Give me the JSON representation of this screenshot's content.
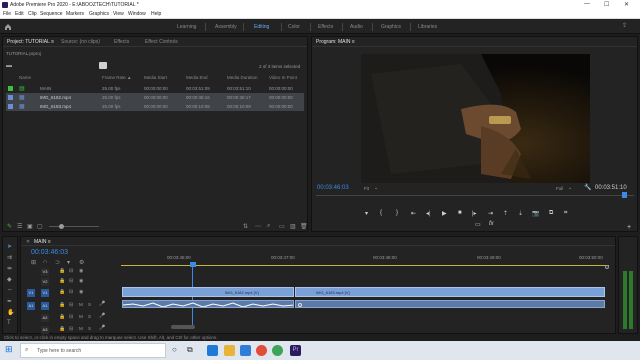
{
  "app": {
    "window_title": "Adobe Premiere Pro 2020 - E:\\ABOOZTECH\\TUTORIAL *",
    "minimize": "—",
    "maximize": "☐",
    "close": "✕"
  },
  "menu": [
    "File",
    "Edit",
    "Clip",
    "Sequence",
    "Markers",
    "Graphics",
    "View",
    "Window",
    "Help"
  ],
  "workspaces": {
    "home_icon": "home-icon",
    "items": [
      "Learning",
      "Assembly",
      "Editing",
      "Color",
      "Effects",
      "Audio",
      "Graphics",
      "Libraries"
    ],
    "active": "Editing"
  },
  "project_panel": {
    "tabs": [
      "Project: TUTORIAL ≡",
      "Source: (no clips)",
      "Effects",
      "Effect Controls"
    ],
    "file_name": "TUTORIAL.prproj",
    "selection_status": "2 of 3 items selected",
    "columns": [
      "Name",
      "Frame Rate ▲",
      "Media Start",
      "Media End",
      "Media Duration",
      "Video In Point"
    ],
    "rows": [
      {
        "name": "MAIN",
        "frame_rate": "25.00 fps",
        "start": "00:00:00:00",
        "end": "00:03:51:09",
        "duration": "00:03:51:10",
        "in_point": "00:00:00:00",
        "color": "#3dbf3d",
        "selected": false
      },
      {
        "name": "IMG_6182.mp4",
        "frame_rate": "25.00 fps",
        "start": "00:00:00:00",
        "end": "00:00:36:16",
        "duration": "00:00:36:17",
        "in_point": "00:00:00:00",
        "color": "#6b8dd6",
        "selected": true
      },
      {
        "name": "IMG_6183.mp4",
        "frame_rate": "25.00 fps",
        "start": "00:00:00:00",
        "end": "00:00:10:08",
        "duration": "00:00:10:09",
        "in_point": "00:00:00:00",
        "color": "#6b8dd6",
        "selected": true
      }
    ]
  },
  "program_monitor": {
    "tab": "Program: MAIN ≡",
    "current_time": "00:03:46:03",
    "fit": "Fit",
    "quality": "Full",
    "duration": "00:03:51:10"
  },
  "timeline": {
    "tab": "MAIN ≡",
    "timecode": "00:03:46:03",
    "ruler": [
      "00:03:46:00",
      "00:03:47:00",
      "00:03:48:00",
      "00:03:49:00",
      "00:03:50:00"
    ],
    "tracks": [
      {
        "id": "V3",
        "type": "video"
      },
      {
        "id": "V2",
        "type": "video"
      },
      {
        "id": "V1",
        "type": "video"
      },
      {
        "id": "A1",
        "type": "audio"
      },
      {
        "id": "A2",
        "type": "audio"
      },
      {
        "id": "A3",
        "type": "audio"
      }
    ],
    "clip1": "IMG_6182.mp4 [V]",
    "clip2": "IMG_6183.mp4 [V]"
  },
  "status": "Click to select, or click in empty space and drag to marquee select. Use Shift, Alt, and Ctrl for other options.",
  "taskbar": {
    "search_placeholder": "Type here to search"
  },
  "colors": {
    "accent": "#4a8bd6",
    "timecode": "#3b8be6",
    "clip": "#7aa0d8",
    "green": "#3dbf3d"
  }
}
